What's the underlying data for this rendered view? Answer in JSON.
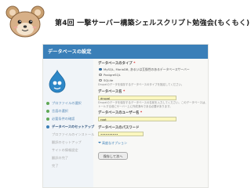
{
  "slide": {
    "title": "第4回 一撃サーバー構築シェルスクリプト勉強会(もくもく)"
  },
  "installer": {
    "page_title": "データベースの設定",
    "steps": [
      {
        "label": "プロファイルの選択",
        "state": "done"
      },
      {
        "label": "言語の選択",
        "state": "done"
      },
      {
        "label": "必要条件の確認",
        "state": "done"
      },
      {
        "label": "データベースのセットアップ",
        "state": "current"
      },
      {
        "label": "プロファイルのインストール",
        "state": "todo"
      },
      {
        "label": "翻訳のセットアップ",
        "state": "todo"
      },
      {
        "label": "サイトの情報設定",
        "state": "todo"
      },
      {
        "label": "翻訳の完了",
        "state": "todo"
      },
      {
        "label": "完了",
        "state": "todo"
      }
    ],
    "db_type": {
      "label": "データベースのタイプ",
      "required_mark": "*",
      "options": [
        {
          "label": "MySQL, MariaDB, あるいは互換性のあるデータベースサーバー",
          "selected": true
        },
        {
          "label": "PostgreSQL",
          "selected": false
        },
        {
          "label": "SQLite",
          "selected": false
        }
      ],
      "help": "Drupalのデータを保存するデータベースのタイプを指定してください。"
    },
    "db_name": {
      "label": "データベース名",
      "required_mark": "*",
      "value": "drupal",
      "help1": "Drupalのデータを保存するデータベースの名前を入力してください。このデータベースは、Drupalをインス",
      "help2": "トールする前にサーバー上に作成済みである必要があります。"
    },
    "db_user": {
      "label": "データベースのユーザー名",
      "required_mark": "*",
      "value": "root"
    },
    "db_password": {
      "label": "データベースのパスワード",
      "value": "••••••••••"
    },
    "advanced_label": "高度なオプション",
    "submit_label": "保存して次へ"
  }
}
